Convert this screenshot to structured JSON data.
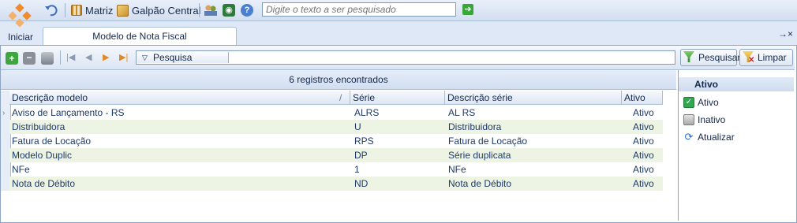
{
  "topbar": {
    "matriz_label": "Matriz",
    "galpao_label": "Galpão Central",
    "search_placeholder": "Digite o texto a ser pesquisado"
  },
  "nav": {
    "iniciar_label": "Iniciar",
    "tab_label": "Modelo de Nota Fiscal",
    "close_glyph": "→×"
  },
  "actions": {
    "filter_label": "Pesquisa",
    "pesquisar_label": "Pesquisar",
    "limpar_label": "Limpar"
  },
  "grid": {
    "count_text": "6 registros encontrados",
    "headers": [
      "Descrição modelo",
      "Série",
      "Descrição série",
      "Ativo"
    ],
    "sort_glyph": "/",
    "rows": [
      [
        "Aviso de Lançamento - RS",
        "ALRS",
        "AL RS",
        "Ativo"
      ],
      [
        "Distribuidora",
        "U",
        "Distribuidora",
        "Ativo"
      ],
      [
        "Fatura de Locação",
        "RPS",
        "Fatura de Locação",
        "Ativo"
      ],
      [
        "Modelo Duplic",
        "DP",
        "Série duplicata",
        "Ativo"
      ],
      [
        "NFe",
        "1",
        "NFe",
        "Ativo"
      ],
      [
        "Nota de Débito",
        "ND",
        "Nota de Débito",
        "Ativo"
      ]
    ]
  },
  "sidepanel": {
    "title": "Ativo",
    "ativo_label": "Ativo",
    "inativo_label": "Inativo",
    "atualizar_label": "Atualizar"
  },
  "colors": {
    "accent": "#f08a2a",
    "alt_row": "#eef4e3",
    "grid_header": "#d2def0"
  }
}
